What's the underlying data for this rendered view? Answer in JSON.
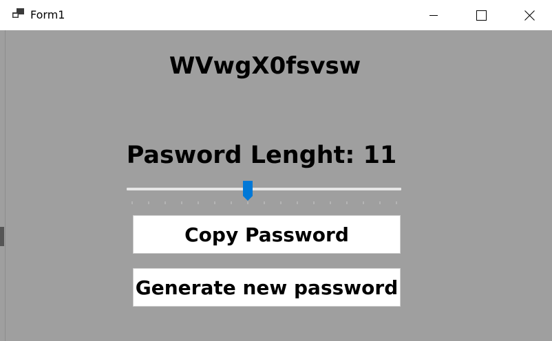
{
  "window": {
    "title": "Form1",
    "icons": {
      "app": "form-app-icon",
      "minimize": "minimize-icon",
      "maximize": "maximize-icon",
      "close": "close-icon"
    }
  },
  "main": {
    "password_text": "WVwgX0fsvsw",
    "length_label": "Pasword Lenght: 11",
    "length_slider": {
      "value": 11,
      "min": 4,
      "max": 20,
      "accent": "#0078d7"
    },
    "copy_button_label": "Copy Password",
    "generate_button_label": "Generate new password"
  },
  "colors": {
    "client_background": "#9f9f9f",
    "titlebar_background": "#ffffff",
    "button_background": "#ffffff",
    "slider_thumb": "#0078d7"
  }
}
